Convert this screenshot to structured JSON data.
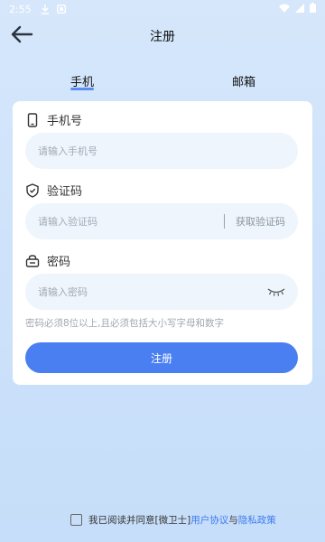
{
  "status_bar": {
    "time": "2:55",
    "icons": [
      "download-icon",
      "notification-icon",
      "wifi-icon",
      "signal-icon",
      "battery-icon"
    ]
  },
  "header": {
    "title": "注册",
    "back_icon": "arrow-left-icon"
  },
  "tabs": [
    {
      "label": "手机",
      "active": true
    },
    {
      "label": "邮箱",
      "active": false
    }
  ],
  "form": {
    "phone": {
      "label": "手机号",
      "placeholder": "请输入手机号",
      "value": ""
    },
    "code": {
      "label": "验证码",
      "placeholder": "请输入验证码",
      "value": "",
      "get_code_label": "获取验证码"
    },
    "password": {
      "label": "密码",
      "placeholder": "请输入密码",
      "value": ""
    },
    "hint": "密码必须8位以上,且必须包括大小写字母和数字",
    "submit_label": "注册"
  },
  "agreement": {
    "prefix": "我已阅读并同意[微卫士]",
    "user_agreement": "用户协议",
    "conjunction": "与",
    "privacy_policy": "隐私政策",
    "checked": false
  },
  "colors": {
    "accent": "#4a7ff1",
    "link": "#3e7bf0",
    "input_bg": "#eef5fd",
    "background": "#d6e7fb"
  }
}
